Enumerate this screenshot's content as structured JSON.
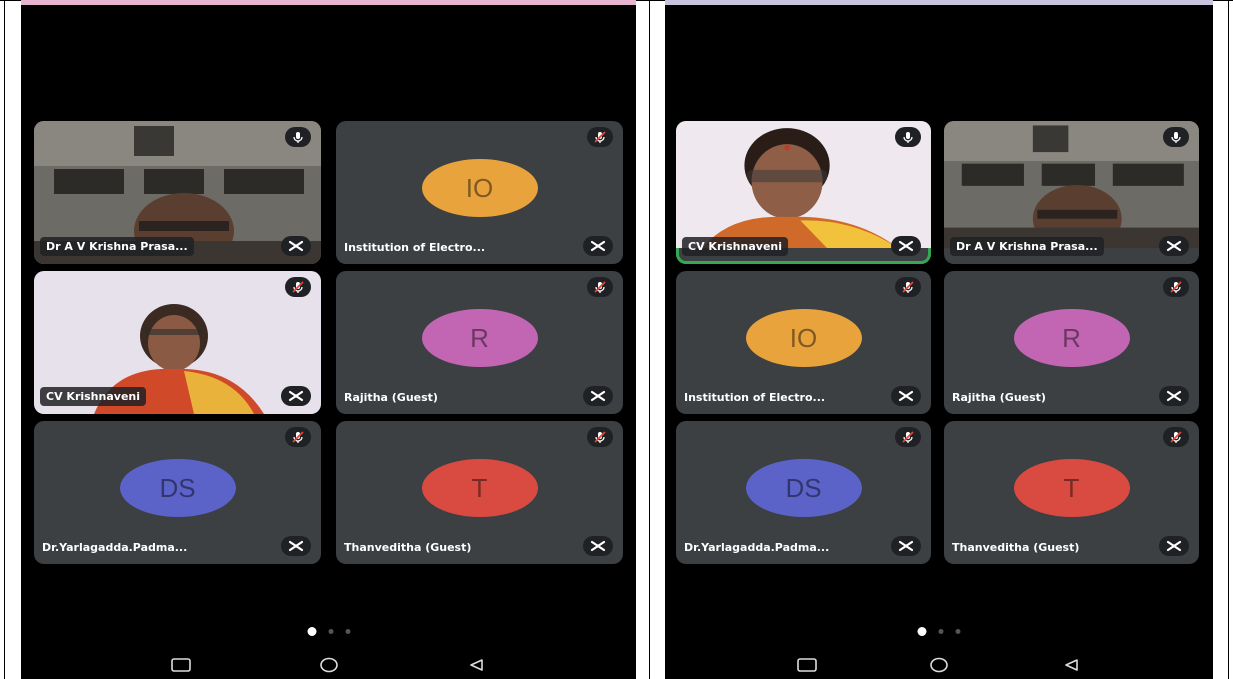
{
  "panels": [
    {
      "id": "left",
      "top_band_color": "#e8b4d0",
      "tiles": [
        {
          "name": "Dr A V Krishna Prasa...",
          "type": "video",
          "speaking": true,
          "muted": false,
          "person": "male-office"
        },
        {
          "name": "Institution of Electro...",
          "type": "avatar",
          "initials": "IO",
          "avatar_color": "#e8a33d",
          "muted": true
        },
        {
          "name": "CV Krishnaveni",
          "type": "video",
          "speaking": false,
          "muted": true,
          "person": "female-saree"
        },
        {
          "name": "Rajitha (Guest)",
          "type": "avatar",
          "initials": "R",
          "avatar_color": "#c266b3",
          "muted": true
        },
        {
          "name": "Dr.Yarlagadda.Padma...",
          "type": "avatar",
          "initials": "DS",
          "avatar_color": "#5b63c9",
          "muted": true
        },
        {
          "name": "Thanveditha (Guest)",
          "type": "avatar",
          "initials": "T",
          "avatar_color": "#d94b41",
          "muted": true
        }
      ]
    },
    {
      "id": "right",
      "top_band_color": "#c9c3dd",
      "tiles": [
        {
          "name": "CV Krishnaveni",
          "type": "video",
          "speaking": true,
          "muted": false,
          "person": "female-closeup"
        },
        {
          "name": "Dr A V Krishna Prasa...",
          "type": "video",
          "speaking": false,
          "muted": false,
          "person": "male-office"
        },
        {
          "name": "Institution of Electro...",
          "type": "avatar",
          "initials": "IO",
          "avatar_color": "#e8a33d",
          "muted": true
        },
        {
          "name": "Rajitha (Guest)",
          "type": "avatar",
          "initials": "R",
          "avatar_color": "#c266b3",
          "muted": true
        },
        {
          "name": "Dr.Yarlagadda.Padma...",
          "type": "avatar",
          "initials": "DS",
          "avatar_color": "#5b63c9",
          "muted": true
        },
        {
          "name": "Thanveditha (Guest)",
          "type": "avatar",
          "initials": "T",
          "avatar_color": "#d94b41",
          "muted": true
        }
      ]
    }
  ],
  "pager": {
    "pages": 3,
    "active": 0
  },
  "navbar": {
    "icons": [
      "recents-square-icon",
      "home-circle-icon",
      "back-triangle-icon"
    ]
  },
  "colors": {
    "tile_bg": "#3c4043",
    "speaking_border": "#34a853"
  }
}
